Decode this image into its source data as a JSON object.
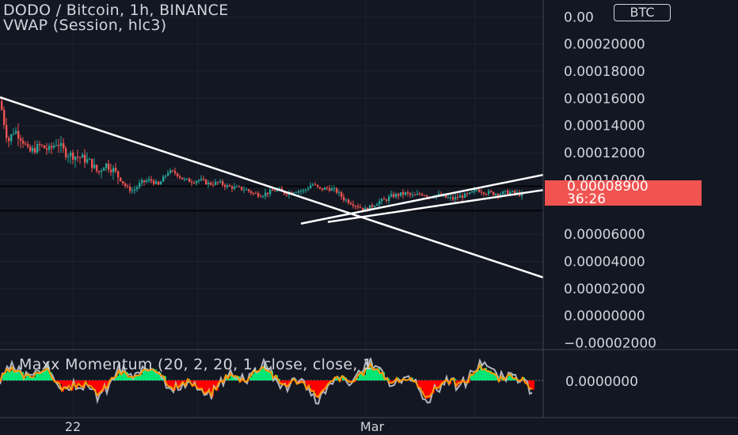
{
  "header": {
    "title": "DODO / Bitcoin, 1h, BINANCE",
    "subtitle": "VWAP (Session, hlc3)",
    "currency_badge": "BTC"
  },
  "indicator": {
    "label": "Maxx Momentum (20, 2, 20, 1, close, close, 1",
    "axis_value": "0.0000000"
  },
  "last_price": {
    "value": "0.00008900",
    "countdown": "36:26"
  },
  "colors": {
    "background": "#131722",
    "up": "#26a69a",
    "down": "#ef5350",
    "trendline": "#ffffff",
    "hist_up": "#00e676",
    "hist_down": "#ff0000",
    "osc_fast": "#ff9800",
    "osc_slow": "#b2b5be"
  },
  "chart_data": {
    "type": "candlestick",
    "title": "DODO / Bitcoin, 1h, BINANCE",
    "y_tick_labels": [
      "0.00",
      "0.00020000",
      "0.00018000",
      "0.00016000",
      "0.00014000",
      "0.00012000",
      "0.00010000",
      "0.00006000",
      "0.00004000",
      "0.00002000",
      "0.00000000",
      "−0.00002000"
    ],
    "y_ticks": [
      0.00022,
      0.0002,
      0.00018,
      0.00016,
      0.00014,
      0.00012,
      0.0001,
      6e-05,
      4e-05,
      2e-05,
      0.0,
      -2e-05
    ],
    "ylim": [
      -2.2e-05,
      0.000226
    ],
    "x_tick_labels": [
      "22",
      "Mar"
    ],
    "horizontal_levels": [
      9.53e-05,
      7.73e-05
    ],
    "price_path": [
      [
        0,
        0.000158
      ],
      [
        4,
        0.000145
      ],
      [
        10,
        0.000128
      ],
      [
        18,
        0.000137
      ],
      [
        28,
        0.00013
      ],
      [
        36,
        0.00012
      ],
      [
        50,
        0.000125
      ],
      [
        62,
        0.000122
      ],
      [
        72,
        0.000128
      ],
      [
        82,
        0.00012
      ],
      [
        92,
        0.000118
      ],
      [
        104,
        0.000116
      ],
      [
        114,
        0.000113
      ],
      [
        124,
        0.000105
      ],
      [
        132,
        0.000112
      ],
      [
        142,
        0.000108
      ],
      [
        150,
        0.000102
      ],
      [
        160,
        9.4e-05
      ],
      [
        168,
        9.2e-05
      ],
      [
        178,
        9.8e-05
      ],
      [
        190,
        0.0001
      ],
      [
        200,
        9.6e-05
      ],
      [
        212,
        0.000106
      ],
      [
        222,
        0.000105
      ],
      [
        232,
        0.0001
      ],
      [
        242,
        9.9e-05
      ],
      [
        252,
        0.0001
      ],
      [
        264,
        9.7e-05
      ],
      [
        276,
        9.8e-05
      ],
      [
        288,
        9.5e-05
      ],
      [
        300,
        9.4e-05
      ],
      [
        310,
        9.3e-05
      ],
      [
        320,
        9e-05
      ],
      [
        330,
        8.9e-05
      ],
      [
        340,
        9.1e-05
      ],
      [
        350,
        9.3e-05
      ],
      [
        360,
        9e-05
      ],
      [
        372,
        9.2e-05
      ],
      [
        384,
        9.2e-05
      ],
      [
        394,
        9.7e-05
      ],
      [
        404,
        9.3e-05
      ],
      [
        414,
        9.4e-05
      ],
      [
        424,
        9.2e-05
      ],
      [
        434,
        8.6e-05
      ],
      [
        444,
        8.3e-05
      ],
      [
        454,
        8e-05
      ],
      [
        462,
        7.8e-05
      ],
      [
        470,
        8.1e-05
      ],
      [
        478,
        8.4e-05
      ],
      [
        486,
        8.5e-05
      ],
      [
        494,
        8.8e-05
      ],
      [
        502,
        8.9e-05
      ],
      [
        512,
        9e-05
      ],
      [
        522,
        8.8e-05
      ],
      [
        532,
        9e-05
      ],
      [
        542,
        8.8e-05
      ],
      [
        552,
        8.9e-05
      ],
      [
        562,
        8.7e-05
      ],
      [
        572,
        8.6e-05
      ],
      [
        582,
        8.8e-05
      ],
      [
        592,
        8.9e-05
      ],
      [
        602,
        9.3e-05
      ],
      [
        612,
        9.1e-05
      ],
      [
        622,
        9e-05
      ],
      [
        632,
        9e-05
      ],
      [
        642,
        9.1e-05
      ],
      [
        652,
        9e-05
      ],
      [
        660,
        8.9e-05
      ]
    ],
    "trendlines": [
      {
        "x1": 0,
        "y1": 0.0001608,
        "x2": 686,
        "y2": 2.82e-05
      },
      {
        "x1": 380,
        "y1": 6.78e-05,
        "x2": 686,
        "y2": 0.0001037
      },
      {
        "x1": 414,
        "y1": 6.9e-05,
        "x2": 686,
        "y2": 9.25e-05
      }
    ]
  }
}
